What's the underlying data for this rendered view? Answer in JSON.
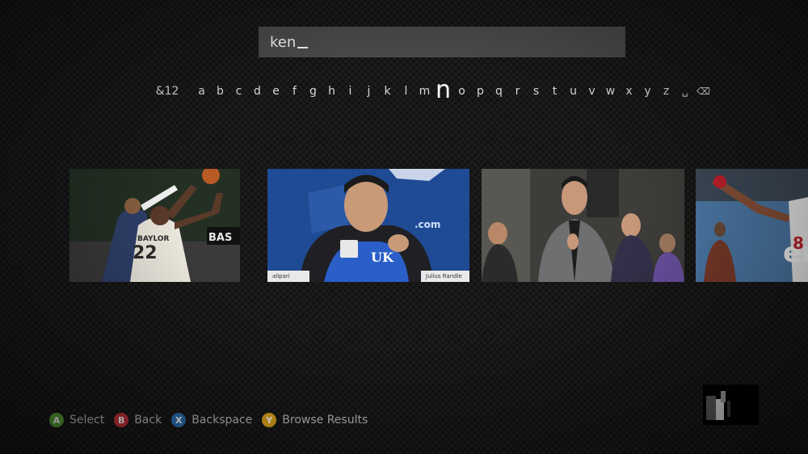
{
  "search": {
    "query": "ken"
  },
  "keyboard": {
    "symbols_key": "&12",
    "letters": [
      "a",
      "b",
      "c",
      "d",
      "e",
      "f",
      "g",
      "h",
      "i",
      "j",
      "k",
      "l",
      "m",
      "n",
      "o",
      "p",
      "q",
      "r",
      "s",
      "t",
      "u",
      "v",
      "w",
      "x",
      "y",
      "z"
    ],
    "selected_letter": "n",
    "space_glyph": "␣",
    "backspace_glyph": "⌫"
  },
  "results": [
    {
      "jersey_number": "22",
      "team": "BAYLOR",
      "ad_text": "BAS"
    },
    {
      "brand": ".com",
      "logo": "UK",
      "nameplate_left": "alipari",
      "nameplate_right": "Julius Randle"
    },
    {},
    {
      "sign_text": "er",
      "jersey_number": "8"
    }
  ],
  "hints": [
    {
      "button": "A",
      "label": "Select",
      "color": "#5ca33a"
    },
    {
      "button": "B",
      "label": "Back",
      "color": "#c8313c"
    },
    {
      "button": "X",
      "label": "Backspace",
      "color": "#2d6fb4"
    },
    {
      "button": "Y",
      "label": "Browse Results",
      "color": "#e0a41b"
    }
  ],
  "icons": [
    "controller-a-button-icon",
    "controller-b-button-icon",
    "controller-x-button-icon",
    "controller-y-button-icon",
    "backspace-icon",
    "space-icon"
  ]
}
